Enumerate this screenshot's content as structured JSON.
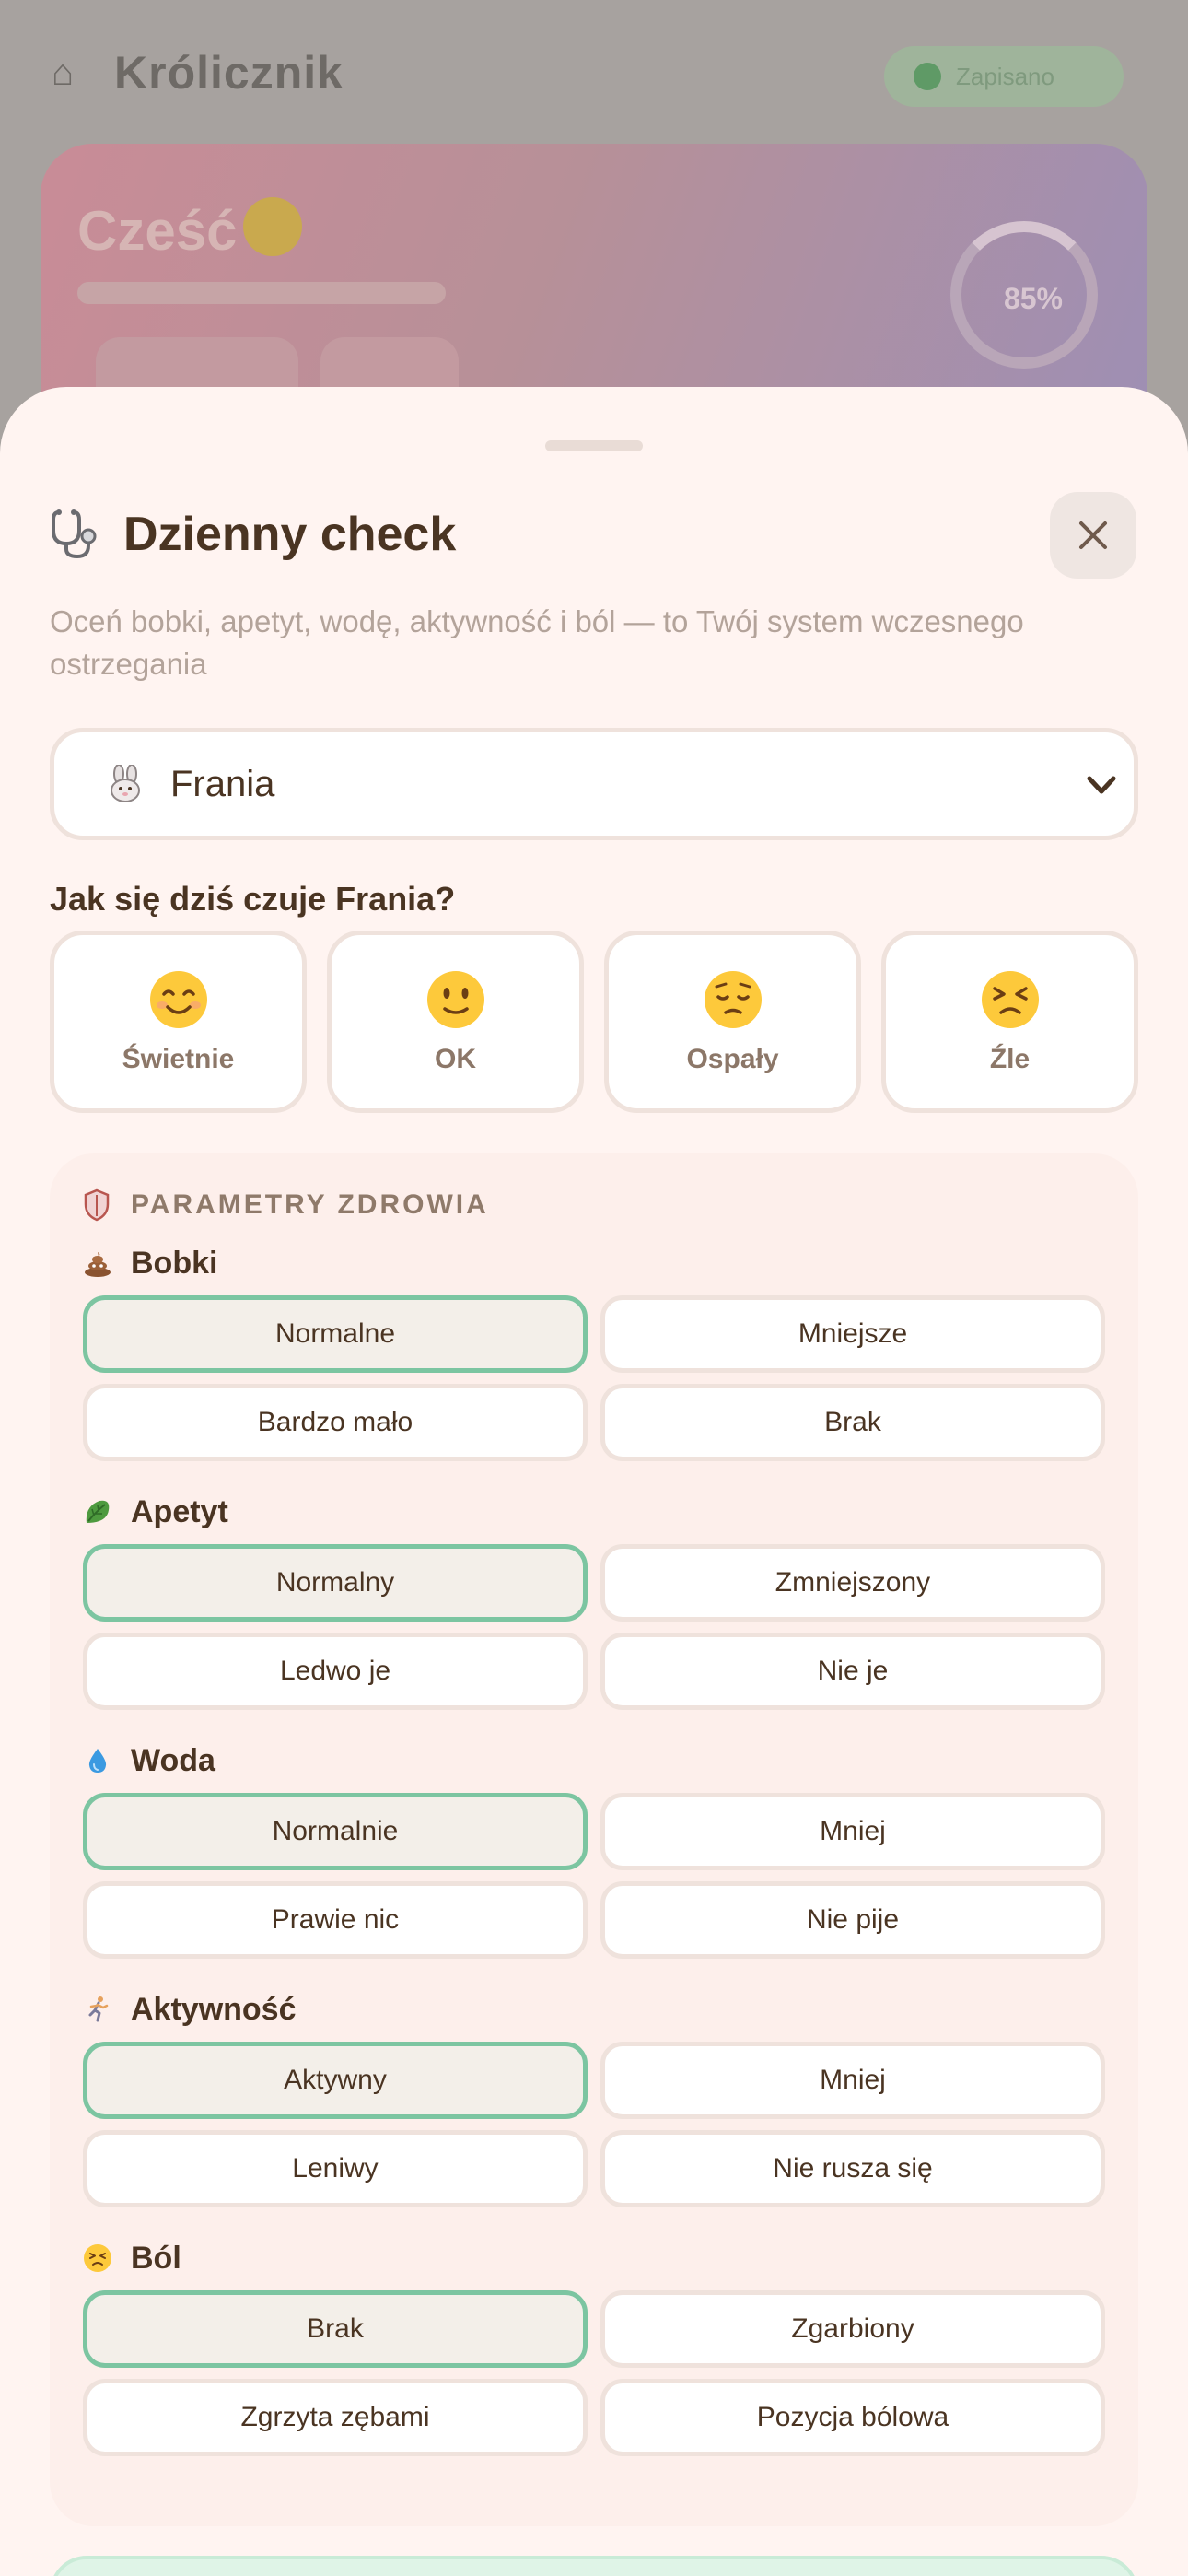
{
  "background": {
    "app_title": "Królicznik",
    "sync_label": "Zapisano",
    "hero_greeting": "Cześć",
    "hero_percent": "85%"
  },
  "sheet": {
    "title": "Dzienny check",
    "description": "Oceń bobki, apetyt, wodę, aktywność i ból — to Twój system wczesnego ostrzegania",
    "selected_rabbit": "Frania",
    "mood_question": "Jak się dziś czuje Frania?",
    "moods": [
      {
        "label": "Świetnie",
        "icon": "smiling-face-icon"
      },
      {
        "label": "OK",
        "icon": "slight-smile-icon"
      },
      {
        "label": "Ospały",
        "icon": "pensive-face-icon"
      },
      {
        "label": "Źle",
        "icon": "persevering-face-icon"
      }
    ],
    "params_title": "PARAMETRY ZDROWIA",
    "groups": [
      {
        "title": "Bobki",
        "icon": "poop-icon",
        "options": [
          "Normalne",
          "Mniejsze",
          "Bardzo mało",
          "Brak"
        ],
        "selected": "Normalne"
      },
      {
        "title": "Apetyt",
        "icon": "leafy-green-icon",
        "options": [
          "Normalny",
          "Zmniejszony",
          "Ledwo je",
          "Nie je"
        ],
        "selected": "Normalny"
      },
      {
        "title": "Woda",
        "icon": "droplet-icon",
        "options": [
          "Normalnie",
          "Mniej",
          "Prawie nic",
          "Nie pije"
        ],
        "selected": "Normalnie"
      },
      {
        "title": "Aktywność",
        "icon": "running-icon",
        "options": [
          "Aktywny",
          "Mniej",
          "Leniwy",
          "Nie rusza się"
        ],
        "selected": "Aktywny"
      },
      {
        "title": "Ból",
        "icon": "persevering-face-icon",
        "options": [
          "Brak",
          "Zgarbiony",
          "Zgrzyta zębami",
          "Pozycja bólowa"
        ],
        "selected": "Brak"
      }
    ]
  },
  "colors": {
    "sheet_bg": "#fff4f1",
    "selected_border": "#7cc5a1",
    "text_dark": "#4a3422",
    "text_muted": "#b3a39a"
  }
}
